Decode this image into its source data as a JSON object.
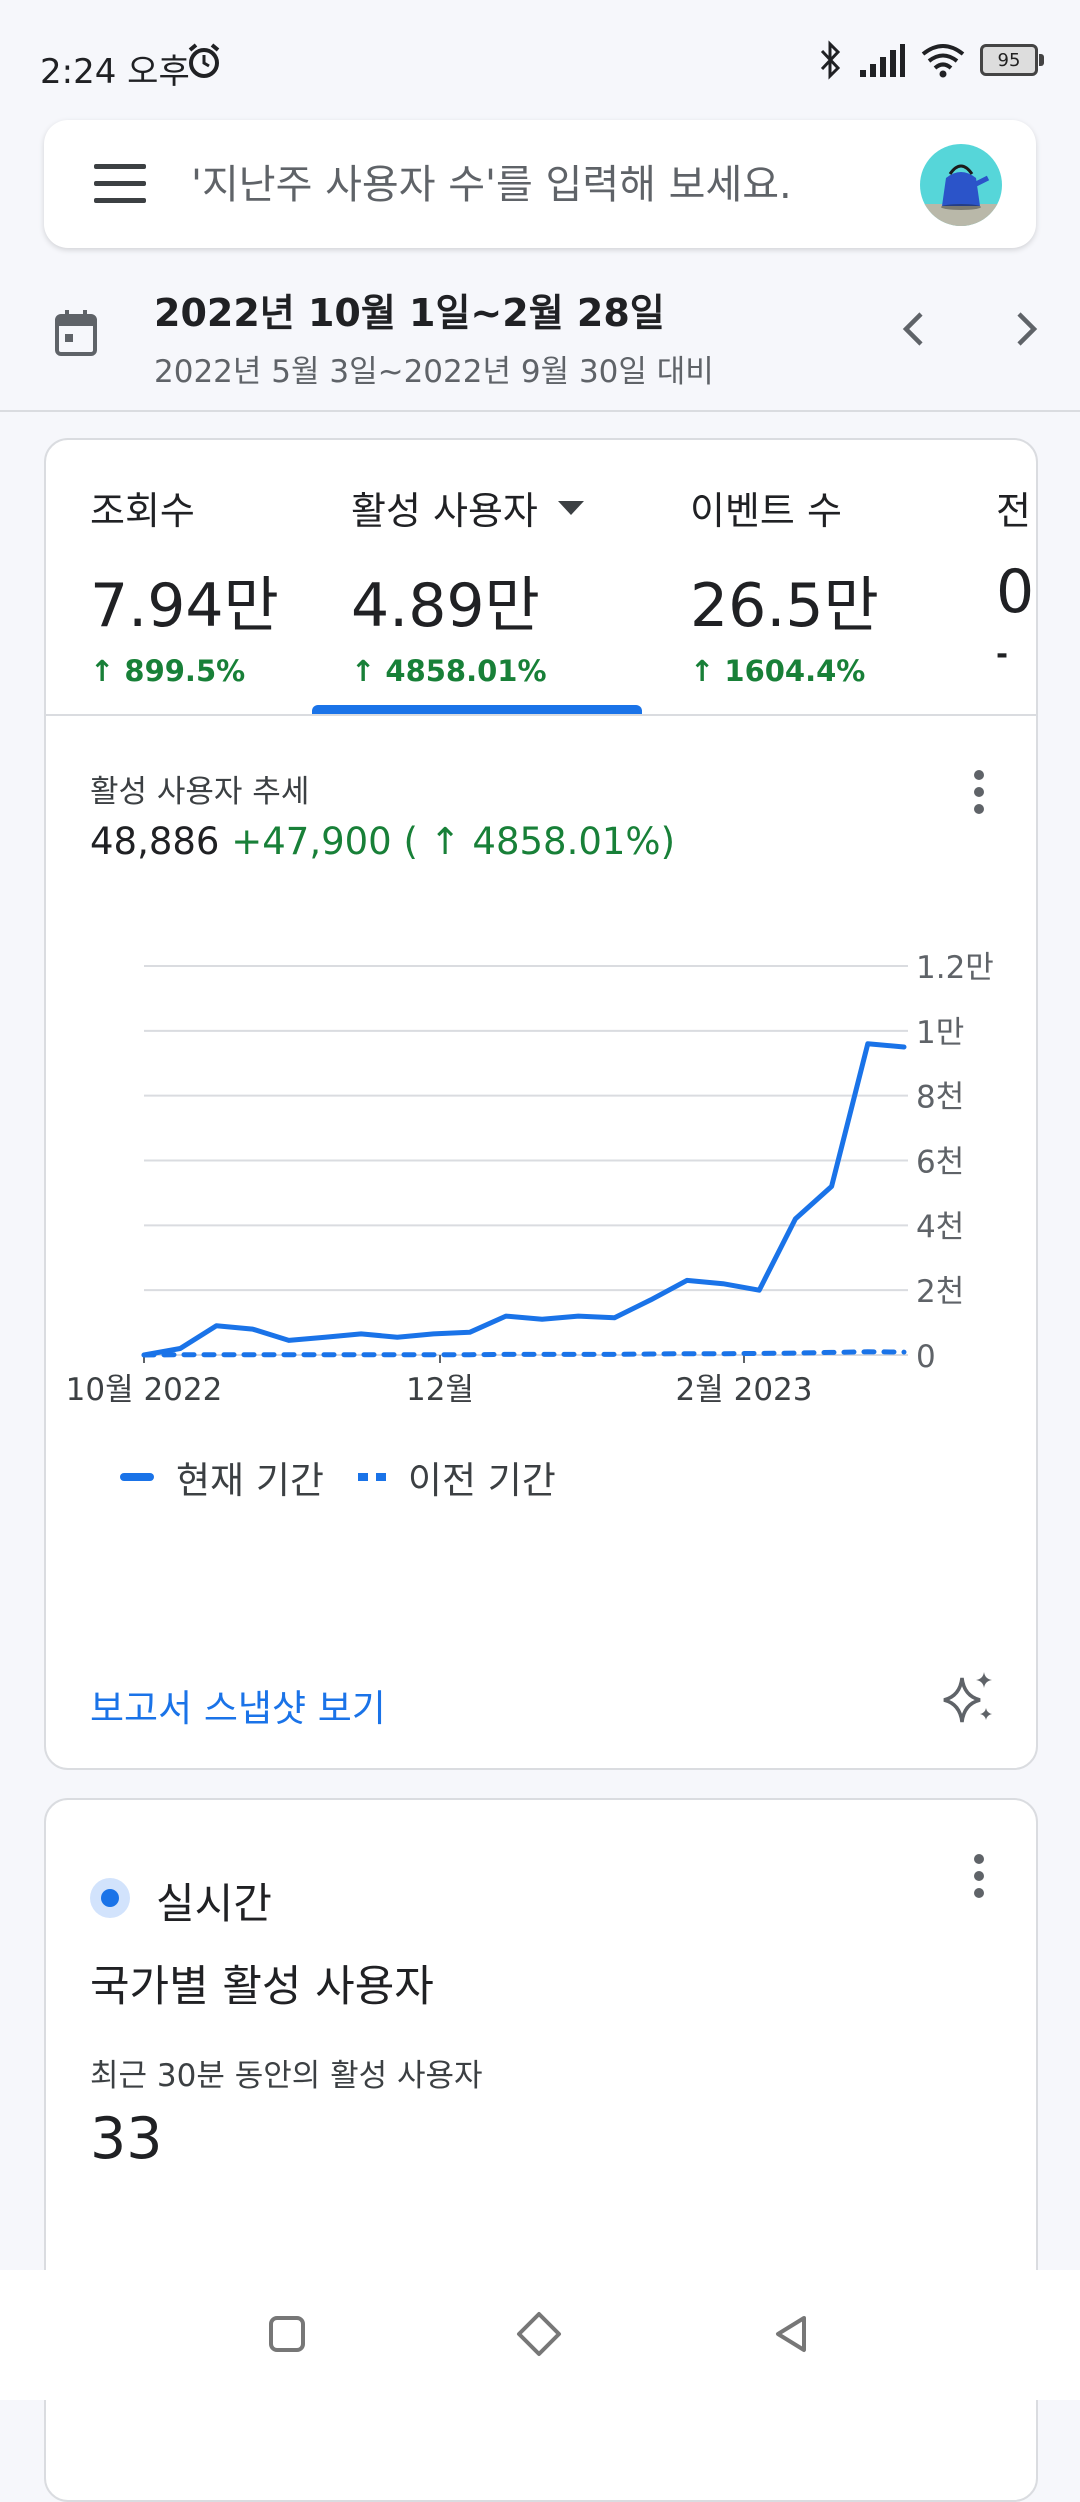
{
  "status_bar": {
    "time": "2:24 오후",
    "battery": "95"
  },
  "search": {
    "placeholder": "'지난주 사용자 수'를 입력해 보세요."
  },
  "date_range": {
    "primary": "2022년 10월 1일~2월 28일",
    "comparison": "2022년 5월 3일~2022년 9월 30일 대비"
  },
  "metrics": [
    {
      "label": "조회수",
      "value": "7.94만",
      "change": "↑ 899.5%"
    },
    {
      "label": "활성 사용자",
      "value": "4.89만",
      "change": "↑ 4858.01%"
    },
    {
      "label": "이벤트 수",
      "value": "26.5만",
      "change": "↑ 1604.4%"
    },
    {
      "label": "전",
      "value": "0",
      "change": "-"
    }
  ],
  "trend": {
    "title": "활성 사용자 추세",
    "total": "48,886",
    "delta": "+47,900 ( ↑ 4858.01%)"
  },
  "chart_data": {
    "type": "line",
    "x_labels": [
      "10월 2022",
      "12월",
      "2월 2023"
    ],
    "y_ticks": [
      "0",
      "2천",
      "4천",
      "6천",
      "8천",
      "1만",
      "1.2만"
    ],
    "ylim": [
      0,
      12000
    ],
    "grid": true,
    "legend_position": "bottom-left",
    "series": [
      {
        "name": "현재 기간",
        "style": "solid",
        "values": [
          0,
          200,
          900,
          800,
          450,
          550,
          650,
          550,
          650,
          700,
          1200,
          1100,
          1200,
          1150,
          1700,
          2300,
          2200,
          2000,
          4200,
          5200,
          9600,
          9500
        ]
      },
      {
        "name": "이전 기간",
        "style": "dashed",
        "values": [
          0,
          10,
          10,
          10,
          10,
          10,
          10,
          10,
          10,
          10,
          20,
          20,
          20,
          20,
          30,
          40,
          40,
          50,
          60,
          80,
          100,
          90
        ]
      }
    ]
  },
  "report_link": "보고서 스냅샷 보기",
  "realtime": {
    "badge": "실시간",
    "title": "국가별 활성 사용자",
    "caption": "최근 30분 동안의 활성 사용자",
    "count": "33"
  },
  "colors": {
    "accent": "#1a73e8",
    "positive": "#188038"
  }
}
